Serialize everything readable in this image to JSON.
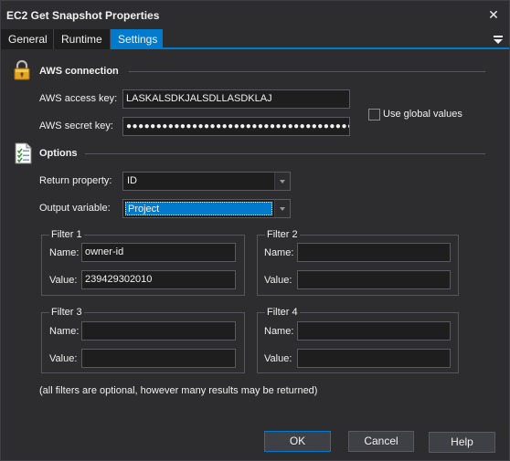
{
  "window": {
    "title": "EC2 Get Snapshot Properties",
    "close_glyph": "✕"
  },
  "tabs": [
    {
      "label": "General"
    },
    {
      "label": "Runtime"
    },
    {
      "label": "Settings"
    }
  ],
  "active_tab": "Settings",
  "aws_connection": {
    "heading": "AWS connection",
    "icon": "lock-icon",
    "access_key_label": "AWS access key:",
    "access_key_value": "LASKALSDKJALSDLLASDKLAJ",
    "secret_key_label": "AWS secret key:",
    "secret_key_value": "●●●●●●●●●●●●●●●●●●●●●●●●●●●●●●●●●●●●●●●●",
    "use_global_label": "Use global values",
    "use_global_checked": false
  },
  "options": {
    "heading": "Options",
    "icon": "checklist-icon",
    "return_property_label": "Return property:",
    "return_property_value": "ID",
    "output_variable_label": "Output variable:",
    "output_variable_value": "Project"
  },
  "filters": [
    {
      "title": "Filter 1",
      "name_label": "Name:",
      "name_value": "owner-id",
      "value_label": "Value:",
      "value_value": "239429302010"
    },
    {
      "title": "Filter 2",
      "name_label": "Name:",
      "name_value": "",
      "value_label": "Value:",
      "value_value": ""
    },
    {
      "title": "Filter 3",
      "name_label": "Name:",
      "name_value": "",
      "value_label": "Value:",
      "value_value": ""
    },
    {
      "title": "Filter 4",
      "name_label": "Name:",
      "name_value": "",
      "value_label": "Value:",
      "value_value": ""
    }
  ],
  "filters_note": "(all filters are optional, however many results may be returned)",
  "buttons": {
    "ok": "OK",
    "cancel": "Cancel",
    "help": "Help"
  },
  "colors": {
    "background": "#2d2d30",
    "accent": "#007acc",
    "input_bg": "#1e1e1e"
  }
}
